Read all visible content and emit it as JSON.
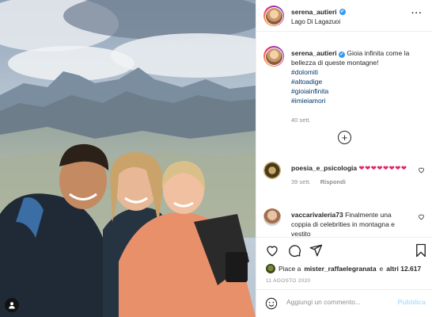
{
  "post": {
    "photo_alt": "",
    "tag_icon": "user-tag-icon"
  },
  "header": {
    "username": "serena_autieri",
    "verified": "✔",
    "location": "Lago Di Lagazuoi",
    "more_icon": "more-icon"
  },
  "caption": {
    "username": "serena_autieri",
    "verified": "✔",
    "text": "Gioia infinita come la bellezza di queste montagne!",
    "hashtags": [
      "#dolomiti",
      "#altoadige",
      "#gioiainfinita",
      "#imieiamori"
    ],
    "time": "40 sett."
  },
  "load_more_icon": "plus-circle-icon",
  "comments": [
    {
      "username": "poesia_e_psicologia",
      "text": "❤❤❤❤❤❤❤❤",
      "time": "39 sett.",
      "reply": "Rispondi"
    },
    {
      "username": "vaccarivaleria73",
      "text": "Finalmente una coppia di celebrities in montagna e vestito"
    }
  ],
  "actions": {
    "like_icon": "heart-icon",
    "comment_icon": "comment-icon",
    "share_icon": "send-icon",
    "save_icon": "bookmark-icon"
  },
  "likes": {
    "prefix": "Piace a",
    "user": "mister_raffaelegranata",
    "conj": "e",
    "others": "altri 12.617"
  },
  "date": "11 AGOSTO 2020",
  "add_comment": {
    "placeholder": "Aggiungi un commento...",
    "publish": "Pubblica"
  },
  "colors": {
    "link": "#00376b",
    "muted": "#8e8e8e",
    "publish_disabled": "#b2dffc",
    "verified": "#3897f0",
    "heart": "#e0245e"
  }
}
